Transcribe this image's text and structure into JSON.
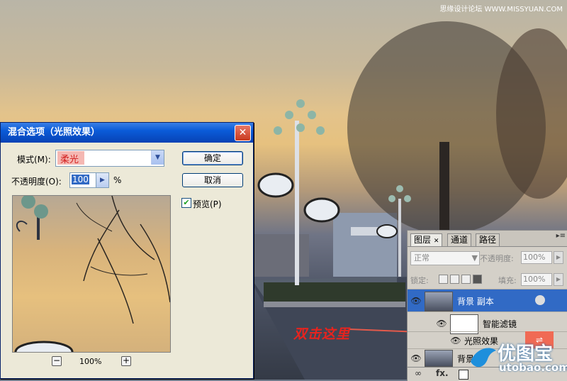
{
  "watermark_top": "思缘设计论坛 WWW.MISSYUAN.COM",
  "annotation": "双击这里",
  "logo": {
    "name": "优图宝",
    "url": "utobao.com"
  },
  "dialog": {
    "title": "混合选项（光照效果）",
    "mode_label": "模式(M):",
    "mode_value": "柔光",
    "opacity_label": "不透明度(O):",
    "opacity_value": "100",
    "opacity_unit": "%",
    "ok_label": "确定",
    "cancel_label": "取消",
    "preview_label": "预览(P)",
    "preview_checked": true,
    "zoom_minus": "−",
    "zoom_plus": "+",
    "zoom_level": "100%"
  },
  "layers_panel": {
    "tabs": [
      "图层",
      "通道",
      "路径"
    ],
    "blend_mode": "正常",
    "opacity_label": "不透明度:",
    "opacity_value": "100%",
    "lock_label": "锁定:",
    "fill_label": "填充:",
    "fill_value": "100%",
    "layers": [
      {
        "name": "背景 副本",
        "selected": true
      },
      {
        "name": "智能滤镜",
        "selected": false
      },
      {
        "name": "光照效果",
        "selected": false
      },
      {
        "name": "背景",
        "selected": false
      }
    ],
    "bottom_icons": [
      "link-icon",
      "fx-icon",
      "mask-icon"
    ]
  },
  "colors": {
    "titlebar": "#0a5bd8",
    "annotation": "#e8231e",
    "highlight": "#f06a54",
    "selection": "#316ac5"
  }
}
